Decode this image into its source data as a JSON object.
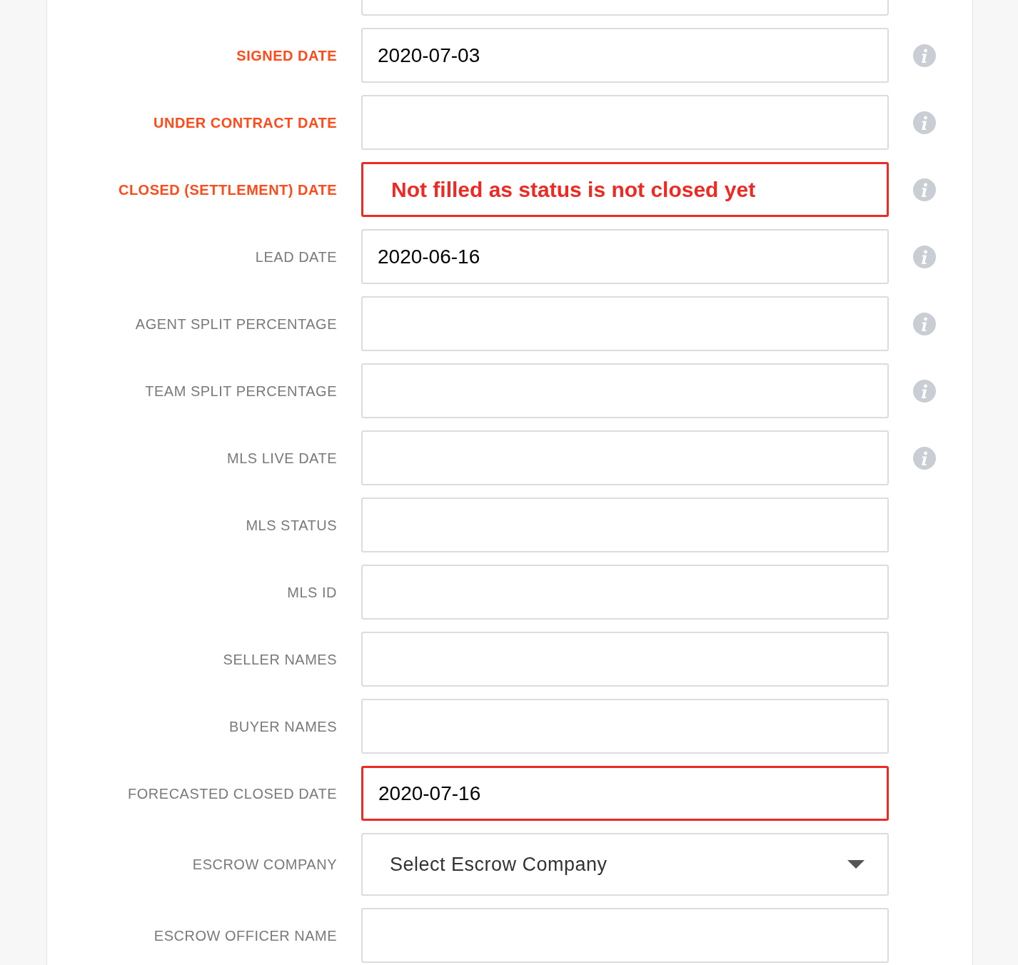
{
  "fields": [
    {
      "kind": "cut"
    },
    {
      "kind": "input",
      "label": "SIGNED DATE",
      "required": true,
      "value": "2020-07-03",
      "info": true,
      "highlighted": false
    },
    {
      "kind": "input",
      "label": "UNDER CONTRACT DATE",
      "required": true,
      "info": true,
      "highlighted": false
    },
    {
      "kind": "input",
      "label": "CLOSED (SETTLEMENT) DATE",
      "required": true,
      "info": true,
      "highlighted": true,
      "annotation": "Not filled as status is not closed yet"
    },
    {
      "kind": "input",
      "label": "LEAD DATE",
      "required": false,
      "value": "2020-06-16",
      "info": true,
      "highlighted": false
    },
    {
      "kind": "input",
      "label": "AGENT SPLIT PERCENTAGE",
      "required": false,
      "info": true,
      "highlighted": false
    },
    {
      "kind": "input",
      "label": "TEAM SPLIT PERCENTAGE",
      "required": false,
      "info": true,
      "highlighted": false
    },
    {
      "kind": "input",
      "label": "MLS LIVE DATE",
      "required": false,
      "info": true,
      "highlighted": false
    },
    {
      "kind": "input",
      "label": "MLS STATUS",
      "required": false,
      "info": false,
      "highlighted": false
    },
    {
      "kind": "input",
      "label": "MLS ID",
      "required": false,
      "info": false,
      "highlighted": false
    },
    {
      "kind": "input",
      "label": "SELLER NAMES",
      "required": false,
      "info": false,
      "highlighted": false
    },
    {
      "kind": "input",
      "label": "BUYER NAMES",
      "required": false,
      "info": false,
      "highlighted": false
    },
    {
      "kind": "input",
      "label": "FORECASTED CLOSED DATE",
      "required": false,
      "value": "2020-07-16",
      "info": false,
      "highlighted": true
    },
    {
      "kind": "select",
      "label": "ESCROW COMPANY",
      "required": false,
      "placeholder": "Select Escrow Company",
      "info": false,
      "highlighted": false
    },
    {
      "kind": "input",
      "label": "ESCROW OFFICER NAME",
      "required": false,
      "info": false,
      "highlighted": false
    }
  ]
}
